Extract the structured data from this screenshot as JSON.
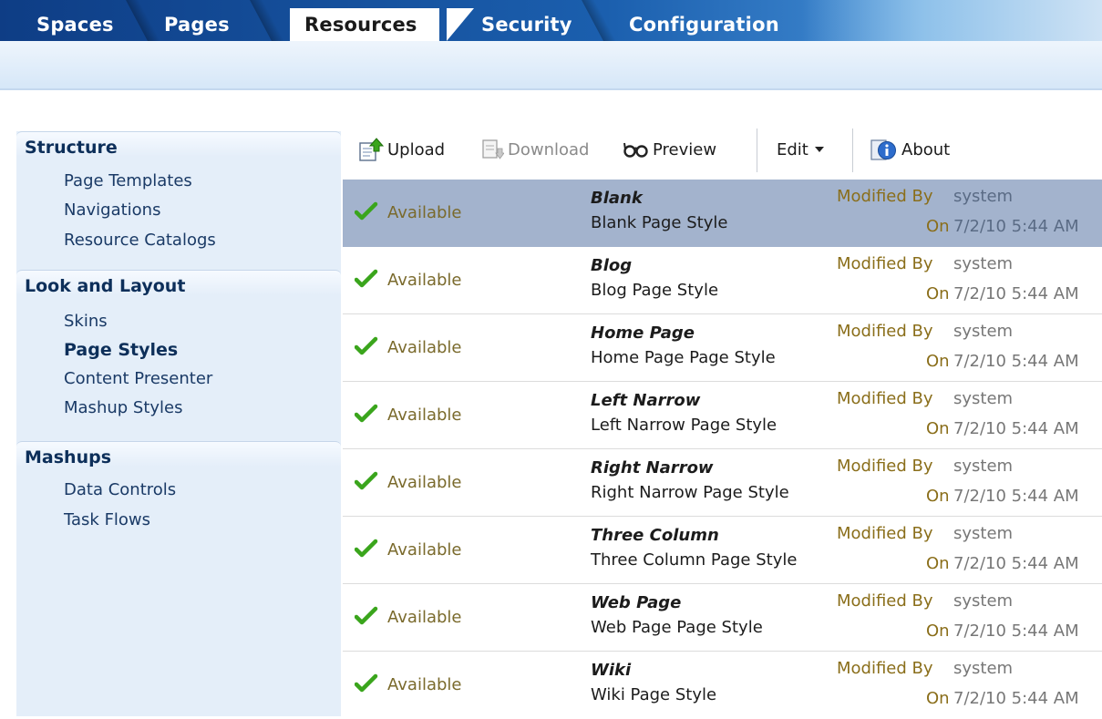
{
  "tabs": [
    {
      "label": "Spaces",
      "active": false
    },
    {
      "label": "Pages",
      "active": false
    },
    {
      "label": "Resources",
      "active": true
    },
    {
      "label": "Security",
      "active": false
    },
    {
      "label": "Configuration",
      "active": false
    }
  ],
  "sidebar": {
    "sections": [
      {
        "title": "Structure",
        "items": [
          "Page Templates",
          "Navigations",
          "Resource Catalogs"
        ]
      },
      {
        "title": "Look and Layout",
        "items": [
          "Skins",
          "Page Styles",
          "Content Presenter",
          "Mashup Styles"
        ],
        "selected": "Page Styles"
      },
      {
        "title": "Mashups",
        "items": [
          "Data Controls",
          "Task Flows"
        ]
      }
    ]
  },
  "toolbar": {
    "upload": "Upload",
    "download": "Download",
    "preview": "Preview",
    "edit": "Edit",
    "about": "About"
  },
  "list": {
    "modified_by_label": "Modified By",
    "on_label": "On",
    "rows": [
      {
        "status": "Available",
        "name": "Blank",
        "description": "Blank Page Style",
        "modified_by": "system",
        "on": "7/2/10 5:44 AM",
        "selected": true
      },
      {
        "status": "Available",
        "name": "Blog",
        "description": "Blog Page Style",
        "modified_by": "system",
        "on": "7/2/10 5:44 AM",
        "selected": false
      },
      {
        "status": "Available",
        "name": "Home Page",
        "description": "Home Page Page Style",
        "modified_by": "system",
        "on": "7/2/10 5:44 AM",
        "selected": false
      },
      {
        "status": "Available",
        "name": "Left Narrow",
        "description": "Left Narrow Page Style",
        "modified_by": "system",
        "on": "7/2/10 5:44 AM",
        "selected": false
      },
      {
        "status": "Available",
        "name": "Right Narrow",
        "description": "Right Narrow Page Style",
        "modified_by": "system",
        "on": "7/2/10 5:44 AM",
        "selected": false
      },
      {
        "status": "Available",
        "name": "Three Column",
        "description": "Three Column Page Style",
        "modified_by": "system",
        "on": "7/2/10 5:44 AM",
        "selected": false
      },
      {
        "status": "Available",
        "name": "Web Page",
        "description": "Web Page Page Style",
        "modified_by": "system",
        "on": "7/2/10 5:44 AM",
        "selected": false
      },
      {
        "status": "Available",
        "name": "Wiki",
        "description": "Wiki Page Style",
        "modified_by": "system",
        "on": "7/2/10 5:44 AM",
        "selected": false
      }
    ]
  },
  "colors": {
    "tab_bar": "#1b5fae",
    "selected_row": "#a3b3cd",
    "nav_background": "#e4eef9",
    "status_text": "#7a6a2c",
    "check_icon": "#3aa51c"
  },
  "icons": {
    "status": "check-icon",
    "upload": "upload-icon",
    "download": "download-icon",
    "preview": "glasses-icon",
    "edit": "chevron-down-icon",
    "about": "info-icon"
  }
}
